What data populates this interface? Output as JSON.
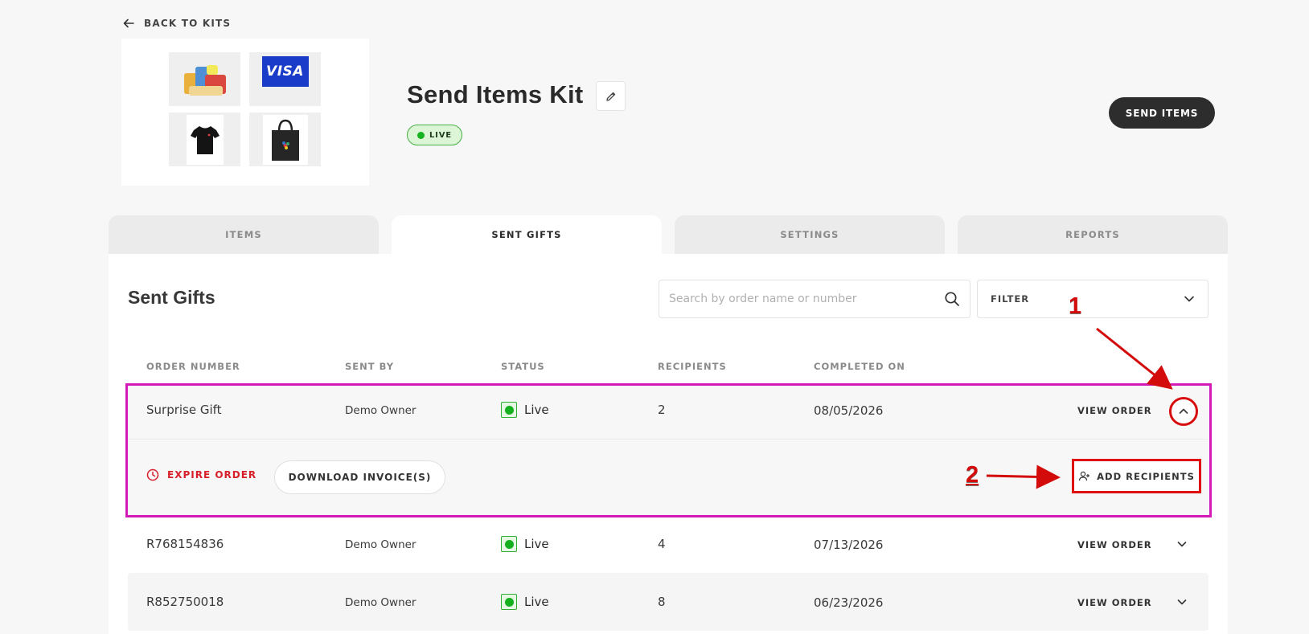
{
  "back_link": {
    "label": "BACK TO KITS"
  },
  "kit": {
    "title": "Send Items Kit",
    "status": "LIVE",
    "visa_text": "VISA",
    "images": [
      "snack-box-image",
      "visa-card-image",
      "tshirt-image",
      "tote-bag-image"
    ]
  },
  "header": {
    "send_button": "SEND ITEMS"
  },
  "tabs": [
    {
      "label": "ITEMS",
      "active": false
    },
    {
      "label": "SENT GIFTS",
      "active": true
    },
    {
      "label": "SETTINGS",
      "active": false
    },
    {
      "label": "REPORTS",
      "active": false
    }
  ],
  "section": {
    "title": "Sent Gifts",
    "search_placeholder": "Search by order name or number",
    "filter_label": "FILTER"
  },
  "table": {
    "columns": [
      "ORDER NUMBER",
      "SENT BY",
      "STATUS",
      "RECIPIENTS",
      "COMPLETED ON"
    ],
    "rows": [
      {
        "order": "Surprise Gift",
        "sent_by": "Demo Owner",
        "status": "Live",
        "recipients": "2",
        "completed_on": "08/05/2026",
        "action": "VIEW ORDER",
        "expanded": true
      },
      {
        "order": "R768154836",
        "sent_by": "Demo Owner",
        "status": "Live",
        "recipients": "4",
        "completed_on": "07/13/2026",
        "action": "VIEW ORDER",
        "expanded": false
      },
      {
        "order": "R852750018",
        "sent_by": "Demo Owner",
        "status": "Live",
        "recipients": "8",
        "completed_on": "06/23/2026",
        "action": "VIEW ORDER",
        "expanded": false
      }
    ],
    "expanded_actions": {
      "expire": "EXPIRE ORDER",
      "download": "DOWNLOAD INVOICE(S)",
      "add_recipients": "ADD RECIPIENTS"
    }
  },
  "annotations": {
    "step1": "1",
    "step2": "2",
    "color": "#d40b0b",
    "highlight_color": "#d21ab8"
  },
  "colors": {
    "live_green": "#14b01e",
    "danger_red": "#d8202a",
    "dark_button": "#2d2d2d"
  }
}
